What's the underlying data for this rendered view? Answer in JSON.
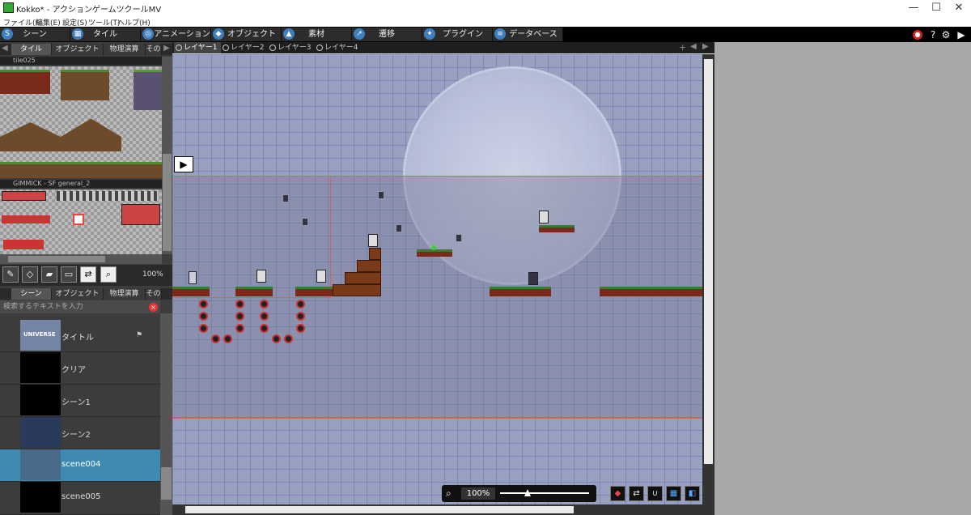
{
  "window": {
    "title": "Kokko* - アクションゲームツクールMV",
    "min": "—",
    "max": "☐",
    "close": "✕"
  },
  "menu": [
    "ファイル(F)",
    "編集(E)",
    "設定(S)",
    "ツール(T)",
    "ヘルプ(H)"
  ],
  "toolbar": [
    {
      "label": "シーン",
      "icon": "scene-icon"
    },
    {
      "label": "タイル",
      "icon": "tile-icon"
    },
    {
      "label": "アニメーション",
      "icon": "animation-icon"
    },
    {
      "label": "オブジェクト",
      "icon": "object-icon"
    },
    {
      "label": "素材",
      "icon": "material-icon"
    },
    {
      "label": "遷移",
      "icon": "transition-icon"
    },
    {
      "label": "プラグイン",
      "icon": "plugin-icon"
    },
    {
      "label": "データベース",
      "icon": "database-icon"
    }
  ],
  "toolbar_right": {
    "help": "?",
    "gear": "⚙",
    "play": "▶",
    "record": "●"
  },
  "tile_panel": {
    "tabs": [
      "タイル",
      "オブジェクト",
      "物理演算",
      "その"
    ],
    "tileset1": "tile025",
    "tileset2": "GIMMICK - SF general_2",
    "zoom": "100%"
  },
  "scene_panel": {
    "tabs": [
      "シーン",
      "オブジェクト",
      "物理演算",
      "その"
    ],
    "search_placeholder": "検索するテキストを入力",
    "scenes": [
      {
        "label": "タイトル",
        "thumb_text": "UNIVERSE"
      },
      {
        "label": "クリア"
      },
      {
        "label": "シーン1"
      },
      {
        "label": "シーン2"
      },
      {
        "label": "scene004"
      },
      {
        "label": "scene005"
      }
    ],
    "selected_index": 4
  },
  "layers": [
    "レイヤー1",
    "レイヤー2",
    "レイヤー3",
    "レイヤー4"
  ],
  "editor": {
    "zoom": "100%",
    "zoom_level": 0.3
  },
  "colors": {
    "accent": "#3d7fbf",
    "selected_row": "#3e8ab0",
    "toolbar_bg": "#000000"
  }
}
